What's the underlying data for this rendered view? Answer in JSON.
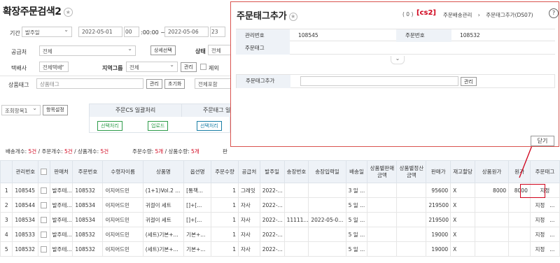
{
  "page": {
    "title": "확장주문검색2"
  },
  "filters": {
    "period_label": "기간",
    "period_type": "발주일",
    "date_from": "2022-05-01",
    "hour_from": "00",
    "time_from": ":00:00 ~",
    "date_to": "2022-05-06",
    "hour_to": "23",
    "time_to": ":5",
    "supplier_label": "공급처",
    "supplier_value": "전체",
    "detail_button": "상세선택",
    "status_label": "상태",
    "status_value": "전체",
    "courier_label": "택배사",
    "courier_value": "전체택배",
    "region_label": "지역그룹",
    "region_value": "전체",
    "manage_button": "관리",
    "exclude_label": "제외",
    "product_tag_label": "상품태그",
    "product_tag_placeholder": "상품태그",
    "product_tag_manage": "관리",
    "product_tag_reset": "초기화",
    "product_tag_mode": "전체포함"
  },
  "view": {
    "preset": "조회항목1",
    "settings_button": "항목설정"
  },
  "bulk": {
    "cs_title": "주문CS 일괄처리",
    "tag_title": "주문태그 일",
    "select_button": "선택처리",
    "upload_button": "업로드",
    "select_button2": "선택처리"
  },
  "summary": {
    "delivery_label": "배송개수:",
    "delivery_value": "5건",
    "order_label": "/ 주문개수:",
    "order_value": "5건",
    "product_label": "/ 상품개수:",
    "product_value": "5건",
    "order_qty_label": "주문수량:",
    "order_qty_value": "5개",
    "product_qty_label": "/ 상품수량:",
    "product_qty_value": "5개",
    "more": "판"
  },
  "table": {
    "headers": [
      "",
      "관리번호",
      "",
      "판매처",
      "주문번호",
      "수령자이름",
      "상품명",
      "옵션명",
      "주문수량",
      "공급처",
      "발주일",
      "송장번호",
      "송장입력일",
      "배송일",
      "상품별판매금액",
      "상품별정산금액",
      "판매가",
      "재고할당",
      "상품원가",
      "원가",
      "주문태그"
    ],
    "rows": [
      [
        "1",
        "108545",
        "",
        "발주테...",
        "108532",
        "이지어드민",
        "(1+1)Vol.2 ...",
        "[통책...",
        "1",
        "그레잇",
        "2022-...",
        "",
        "",
        "3 일 ...",
        "",
        "",
        "95600",
        "X",
        "8000",
        "8000",
        "지정"
      ],
      [
        "2",
        "108544",
        "",
        "발주테...",
        "108534",
        "이지어드민",
        "귀걸이 세트",
        "[]+[...",
        "1",
        "자사",
        "2022-...",
        "",
        "",
        "5 일 ...",
        "",
        "",
        "219500",
        "X",
        "",
        "",
        "지정"
      ],
      [
        "3",
        "108534",
        "",
        "발주테...",
        "108534",
        "이지어드민",
        "귀걸이 세트",
        "[]+[...",
        "1",
        "자사",
        "2022-...",
        "11111...",
        "2022-05-0...",
        "5 일 ...",
        "",
        "",
        "219500",
        "X",
        "",
        "",
        "지정"
      ],
      [
        "4",
        "108533",
        "",
        "발주테...",
        "108532",
        "이지어드민",
        "(세트)기본+...",
        "기본+...",
        "1",
        "자사",
        "2022-...",
        "",
        "",
        "5 일 ...",
        "",
        "",
        "19000",
        "X",
        "",
        "",
        "지정"
      ],
      [
        "5",
        "108532",
        "",
        "발주테...",
        "108532",
        "이지어드민",
        "(세트)기본+...",
        "기본+...",
        "1",
        "자사",
        "2022-...",
        "",
        "",
        "5 일 ...",
        "",
        "",
        "19000",
        "X",
        "",
        "",
        "지정"
      ]
    ],
    "tag_more": "..."
  },
  "modal": {
    "title": "주문태그추가",
    "count": "( 0 )",
    "cs_badge": "[cs2]",
    "breadcrumb_parent": "주문배송관리",
    "breadcrumb_sep": "›",
    "breadcrumb_current": "주문태그추가(DS07)",
    "help": "?",
    "manage_no_label": "관리번호",
    "manage_no_value": "108545",
    "order_no_label": "주문번호",
    "order_no_value": "108532",
    "order_tag_label": "주문태그",
    "order_tag_value": "",
    "add_tag_label": "주문태그추가",
    "add_tag_input": "",
    "manage_button": "관리",
    "close_button": "닫기"
  },
  "colors": {
    "accent_red": "#d0021b",
    "header_bg": "#eef2f7",
    "green": "#2e9c4a",
    "teal": "#1b7fa6"
  }
}
